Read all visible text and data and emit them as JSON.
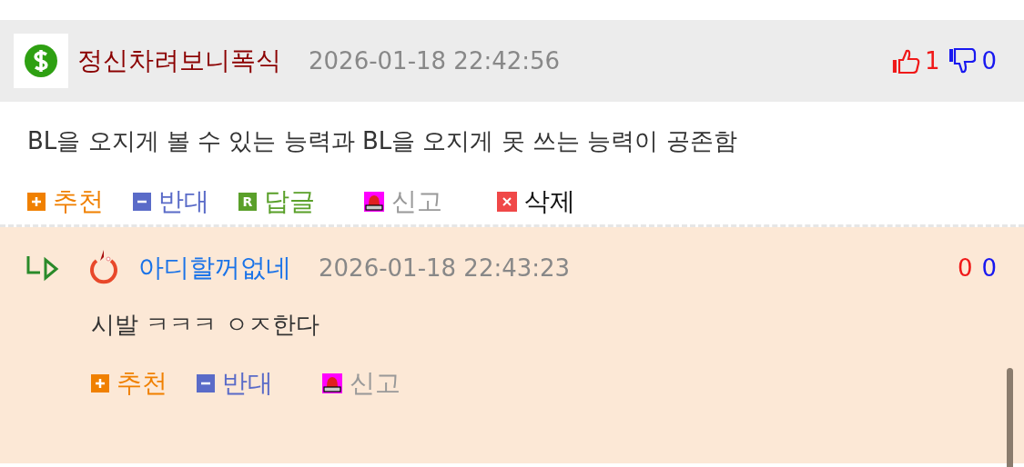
{
  "comments": [
    {
      "kind": "comment",
      "author": "정신차려보니폭식",
      "avatar": {
        "kind": "dollar"
      },
      "date": "2026-01-18 22:42:56",
      "votes": {
        "show_icons": true,
        "up": "1",
        "down": "0"
      },
      "text": "BL을 오지게 볼 수 있는 능력과 BL을 오지게 못 쓰는 능력이 공존함",
      "actions": [
        {
          "kind": "recommend",
          "label": "추천"
        },
        {
          "kind": "oppose",
          "label": "반대"
        },
        {
          "kind": "reply",
          "label": "답글",
          "glyph": "R"
        },
        {
          "kind": "report",
          "label": "신고"
        },
        {
          "kind": "delete",
          "label": "삭제"
        }
      ]
    },
    {
      "kind": "reply",
      "author": "아디할꺼없네",
      "avatar": {
        "kind": "ring"
      },
      "date": "2026-01-18 22:43:23",
      "votes": {
        "show_icons": false,
        "up": "0",
        "down": "0"
      },
      "text": "시발 ㅋㅋㅋ ㅇㅈ한다",
      "actions": [
        {
          "kind": "recommend",
          "label": "추천"
        },
        {
          "kind": "oppose",
          "label": "반대"
        },
        {
          "kind": "report",
          "label": "신고"
        }
      ]
    }
  ]
}
